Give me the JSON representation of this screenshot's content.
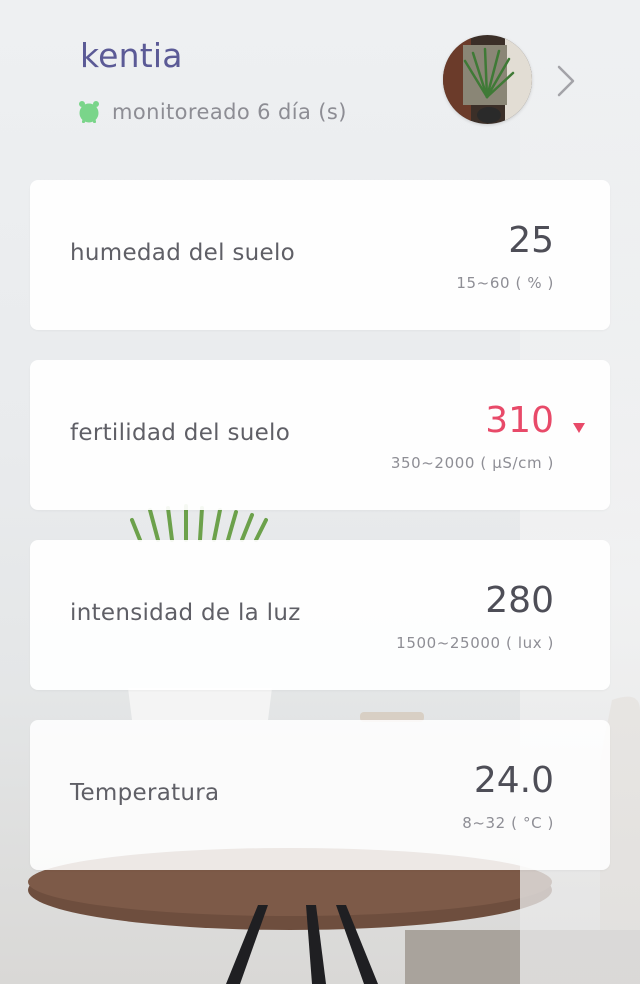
{
  "header": {
    "plant_name": "kentia",
    "monitor_text": "monitoreado 6 día (s)",
    "clock_icon": "alarm-clock-icon",
    "avatar": "plant-photo",
    "chevron_icon": "chevron-right-icon"
  },
  "cards": [
    {
      "label": "humedad del suelo",
      "value": "25",
      "range": "15~60 ( % )",
      "status": "normal"
    },
    {
      "label": "fertilidad del suelo",
      "value": "310",
      "range": "350~2000 ( µS/cm )",
      "status": "low",
      "indicator_icon": "down-triangle-icon"
    },
    {
      "label": "intensidad de la luz",
      "value": "280",
      "range": "1500~25000 ( lux )",
      "status": "normal"
    },
    {
      "label": "Temperatura",
      "value": "24.0",
      "range": "8~32 ( °C )",
      "status": "normal"
    }
  ],
  "colors": {
    "title": "#5b5a96",
    "clock": "#7ad58a",
    "alert": "#e84a69",
    "value": "#4e4e57",
    "label": "#5f5f66",
    "range": "#8e8e95"
  }
}
